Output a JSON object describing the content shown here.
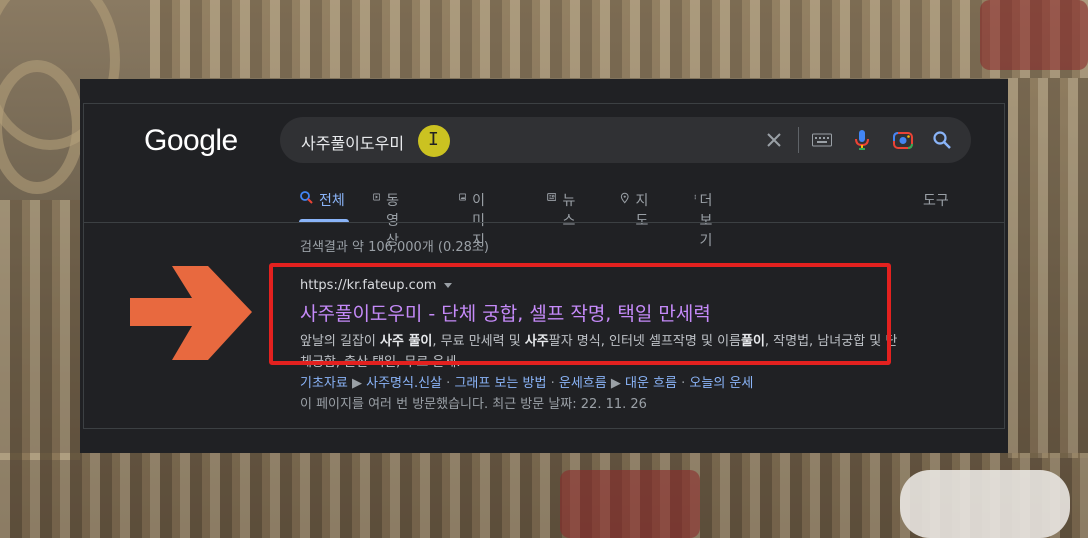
{
  "logo": "Google",
  "search": {
    "value": "사주풀이도우미"
  },
  "icons": {
    "clear": "close-icon",
    "keyboard": "keyboard-icon",
    "voice": "mic-icon",
    "lens": "camera-icon",
    "search": "search-icon"
  },
  "tabs": [
    {
      "label": "전체",
      "icon": "search-icon"
    },
    {
      "label": "동영상",
      "icon": "play-icon"
    },
    {
      "label": "이미지",
      "icon": "image-icon"
    },
    {
      "label": "뉴스",
      "icon": "news-icon"
    },
    {
      "label": "지도",
      "icon": "map-pin-icon"
    },
    {
      "label": "더보기",
      "icon": "more-vert-icon"
    }
  ],
  "tools_label": "도구",
  "stats": "검색결과 약 106,000개 (0.28초)",
  "result": {
    "url": "https://kr.fateup.com",
    "title": "사주풀이도우미 - 단체 궁합, 셀프 작명, 택일 만세력",
    "snippet_parts": [
      "앞날의 길잡이 ",
      "사주 풀이",
      ", 무료 만세력 및 ",
      "사주",
      "팔자 명식, 인터넷 셀프작명 및 이름",
      "풀이",
      ", 작명법, ",
      "남녀궁합 및 단체궁합, 출산 택일, 무료 운세."
    ],
    "sitelinks": [
      "기초자료",
      "사주명식.신살",
      "그래프 보는 방법",
      "운세흐름",
      "대운 흐름",
      "오늘의 운세"
    ],
    "visited": "이 페이지를 여러 번 방문했습니다. 최근 방문 날짜: 22. 11. 26"
  },
  "colors": {
    "background": "#202124",
    "link": "#8ab4f8",
    "visited_title": "#c58af9",
    "highlight": "#e3211f",
    "arrow": "#e8693f"
  }
}
